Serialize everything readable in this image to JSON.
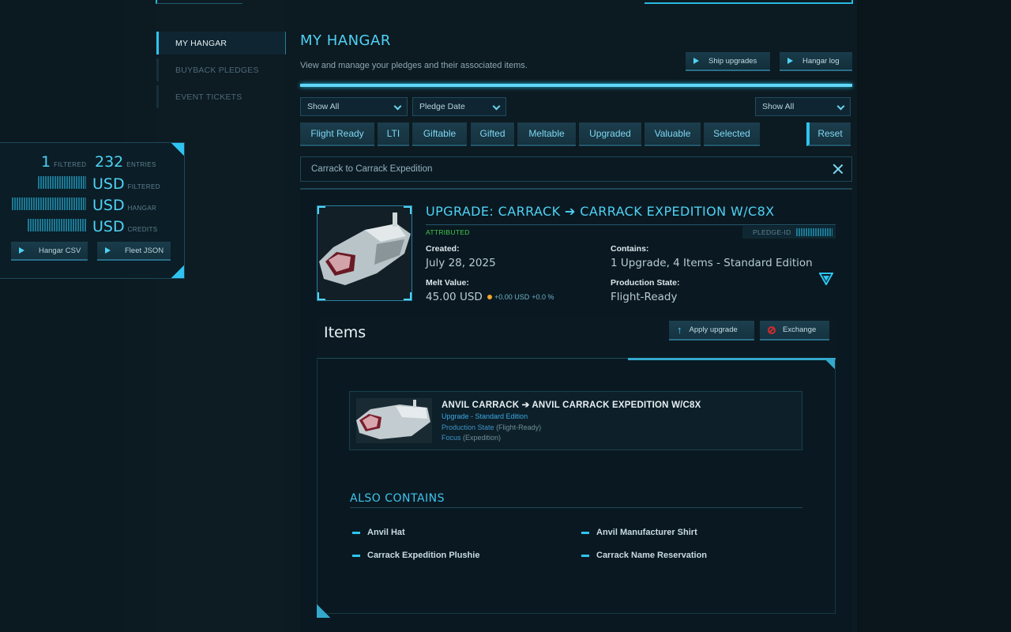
{
  "sidebar": {
    "items": [
      {
        "label": "MY HANGAR",
        "active": true
      },
      {
        "label": "BUYBACK PLEDGES",
        "active": false
      },
      {
        "label": "EVENT TICKETS",
        "active": false
      }
    ]
  },
  "stats": {
    "filtered_count": "1",
    "filtered_label": "FILTERED",
    "entries_count": "232",
    "entries_label": "ENTRIES",
    "currency": "USD",
    "filtered_value_label": "FILTERED",
    "hangar_value_label": "HANGAR",
    "credits_value_label": "CREDITS",
    "csv_button": "Hangar CSV",
    "json_button": "Fleet JSON"
  },
  "header": {
    "title": "MY HANGAR",
    "subtitle": "View and manage your pledges and their associated items.",
    "ship_upgrades_button": "Ship upgrades",
    "hangar_log_button": "Hangar log"
  },
  "filters": {
    "select_type": "Show All",
    "select_sort": "Pledge Date",
    "select_right": "Show All",
    "chips": [
      "Flight Ready",
      "LTI",
      "Giftable",
      "Gifted",
      "Meltable",
      "Upgraded",
      "Valuable",
      "Selected"
    ],
    "reset": "Reset",
    "search_value": "Carrack to Carrack Expedition"
  },
  "pledge": {
    "title": "UPGRADE: CARRACK ➔ CARRACK EXPEDITION W/C8X",
    "status": "ATTRIBUTED",
    "pledge_id_label": "PLEDGE-ID",
    "created_label": "Created:",
    "created_value": "July 28, 2025",
    "contains_label": "Contains:",
    "contains_value": "1 Upgrade, 4 Items - Standard Edition",
    "melt_label": "Melt Value:",
    "melt_value": "45.00 USD",
    "melt_delta_usd": "+0.00 USD",
    "melt_delta_pct": "+0.0 %",
    "production_label": "Production State:",
    "production_value": "Flight-Ready"
  },
  "items_section": {
    "title": "Items",
    "apply_upgrade": "Apply upgrade",
    "exchange": "Exchange",
    "item": {
      "name": "ANVIL CARRACK ➔ ANVIL CARRACK EXPEDITION W/C8X",
      "edition": "Upgrade - Standard Edition",
      "production_prefix": "Production State",
      "production_value": "(Flight-Ready)",
      "focus_prefix": "Focus",
      "focus_value": "(Expedition)"
    },
    "also_contains_title": "ALSO CONTAINS",
    "also_contains": [
      "Anvil Hat",
      "Anvil Manufacturer Shirt",
      "Carrack Expedition Plushie",
      "Carrack Name Reservation"
    ]
  },
  "colors": {
    "accent": "#2ec4ef",
    "title": "#4fd2f5",
    "attributed": "#41c84a",
    "melt_dot": "#f2a52a",
    "exchange_icon": "#d22b2b"
  }
}
